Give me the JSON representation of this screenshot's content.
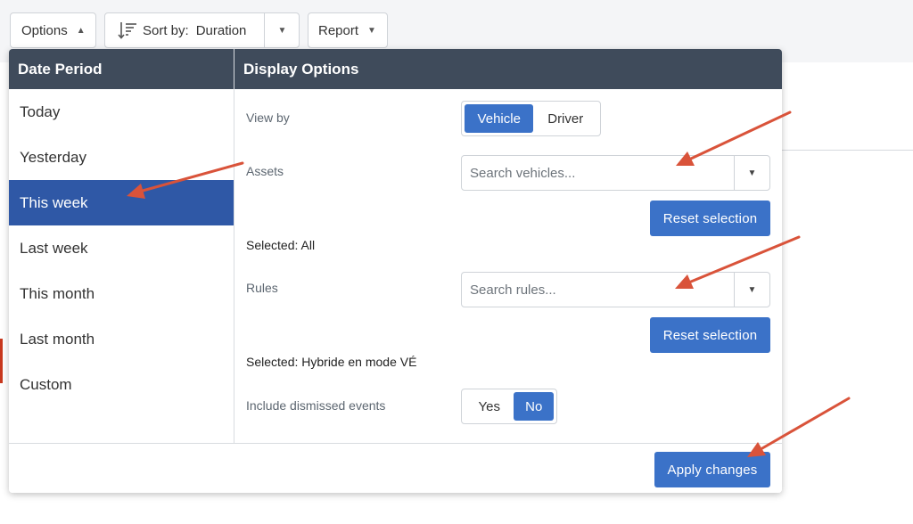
{
  "toolbar": {
    "options_label": "Options",
    "sort_label": "Sort by:",
    "sort_value": "Duration",
    "report_label": "Report"
  },
  "date_period": {
    "heading": "Date Period",
    "items": [
      "Today",
      "Yesterday",
      "This week",
      "Last week",
      "This month",
      "Last month",
      "Custom"
    ],
    "selected": "This week"
  },
  "display_options": {
    "heading": "Display Options",
    "view_by": {
      "label": "View by",
      "options": [
        "Vehicle",
        "Driver"
      ],
      "selected": "Vehicle"
    },
    "assets": {
      "label": "Assets",
      "placeholder": "Search vehicles...",
      "reset_label": "Reset selection",
      "selected_text": "Selected: All"
    },
    "rules": {
      "label": "Rules",
      "placeholder": "Search rules...",
      "reset_label": "Reset selection",
      "selected_text": "Selected: Hybride en mode VÉ"
    },
    "dismissed": {
      "label": "Include dismissed events",
      "options": [
        "Yes",
        "No"
      ],
      "selected": "No"
    }
  },
  "footer": {
    "apply_label": "Apply changes"
  },
  "colors": {
    "header_bg": "#3f4b5b",
    "selected_period": "#2f58a6",
    "accent": "#3b72c8",
    "annotation_arrow": "#d9533a"
  }
}
